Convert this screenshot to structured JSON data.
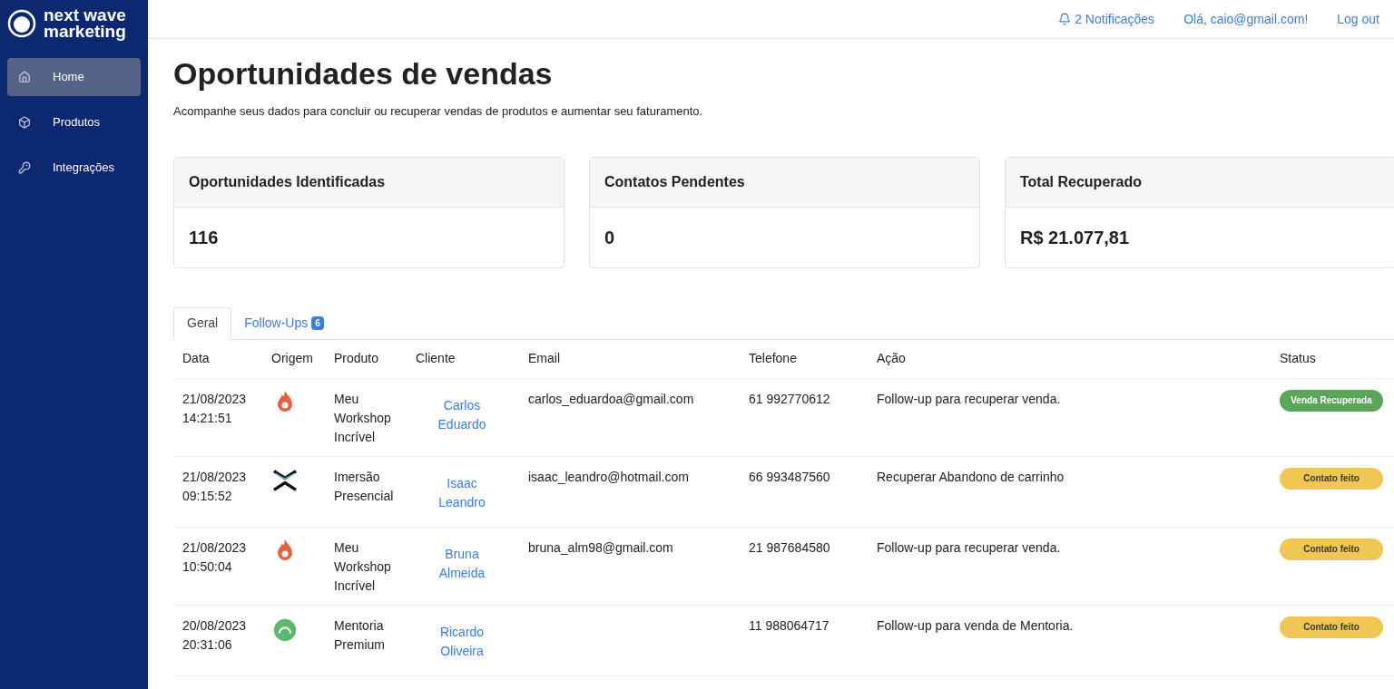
{
  "sidebar": {
    "logo": [
      "next wave",
      "marketing"
    ],
    "items": [
      {
        "label": "Home",
        "selected": true
      },
      {
        "label": "Produtos",
        "selected": false
      },
      {
        "label": "Integrações",
        "selected": false
      }
    ]
  },
  "header": {
    "notifications": "2 Notificações",
    "greeting": "Olá, caio@gmail.com!",
    "logout": "Log out"
  },
  "page": {
    "title": "Oportunidades de vendas",
    "subtitle": "Acompanhe seus dados para concluir ou recuperar vendas de produtos e aumentar seu faturamento."
  },
  "stats": [
    {
      "label": "Oportunidades Identificadas",
      "value": "116"
    },
    {
      "label": "Contatos Pendentes",
      "value": "0"
    },
    {
      "label": "Total Recuperado",
      "value": "R$ 21.077,81"
    }
  ],
  "tabs": [
    {
      "label": "Geral",
      "selected": true
    },
    {
      "label": "Follow-Ups",
      "badge": "6",
      "selected": false
    }
  ],
  "table": {
    "columns": [
      "Data",
      "Origem",
      "Produto",
      "Cliente",
      "Email",
      "Telefone",
      "Ação",
      "Status"
    ],
    "rows": [
      {
        "date": [
          "21/08/2023",
          "14:21:51"
        ],
        "origin": {
          "kind": "flame"
        },
        "product": [
          "Meu",
          "Workshop",
          "Incrível"
        ],
        "client": [
          "Carlos",
          "Eduardo"
        ],
        "email": "carlos_eduardoa@gmail.com",
        "phone": "61 992770612",
        "action": "Follow-up para recuperar venda.",
        "status": {
          "label": "Venda Recuperada",
          "kind": "recovered"
        }
      },
      {
        "date": [
          "21/08/2023",
          "09:15:52"
        ],
        "origin": {
          "kind": "chevrons"
        },
        "product": [
          "Imersão",
          "Presencial"
        ],
        "client": [
          "Isaac",
          "Leandro"
        ],
        "email": "isaac_leandro@hotmail.com",
        "phone": "66 993487560",
        "action": "Recuperar Abandono de carrinho",
        "status": {
          "label": "Contato feito",
          "kind": "contacted"
        }
      },
      {
        "date": [
          "21/08/2023",
          "10:50:04"
        ],
        "origin": {
          "kind": "flame"
        },
        "product": [
          "Meu",
          "Workshop",
          "Incrível"
        ],
        "client": [
          "Bruna",
          "Almeida"
        ],
        "email": "bruna_alm98@gmail.com",
        "phone": "21 987684580",
        "action": "Follow-up para recuperar venda.",
        "status": {
          "label": "Contato feito",
          "kind": "contacted"
        }
      },
      {
        "date": [
          "20/08/2023",
          "20:31:06"
        ],
        "origin": {
          "kind": "circle"
        },
        "product": [
          "Mentoria",
          "Premium"
        ],
        "client": [
          "Ricardo",
          "Oliveira"
        ],
        "phone": "11 988064717",
        "action": "Follow-up para venda de Mentoria.",
        "status": {
          "label": "Contato feito",
          "kind": "contacted"
        }
      }
    ]
  }
}
